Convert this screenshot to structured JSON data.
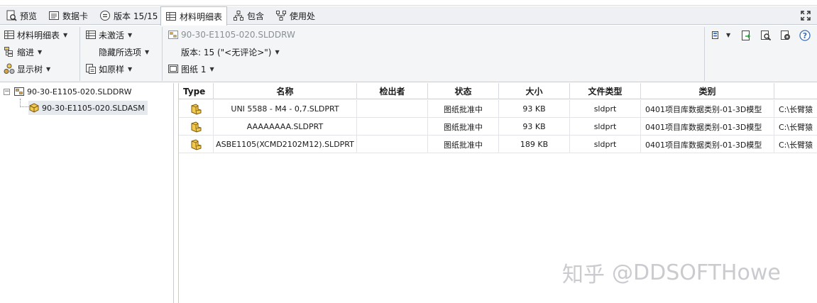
{
  "tabs": [
    {
      "label": "预览",
      "icon": "preview-icon"
    },
    {
      "label": "数据卡",
      "icon": "datacard-icon"
    },
    {
      "label": "版本 15/15",
      "icon": "version-icon"
    },
    {
      "label": "材料明细表",
      "icon": "bom-table-icon",
      "active": true
    },
    {
      "label": "包含",
      "icon": "contains-icon"
    },
    {
      "label": "使用处",
      "icon": "where-used-icon"
    }
  ],
  "toolbar": {
    "bom_label": "材料明细表",
    "indent_label": "缩进",
    "show_tree_label": "显示树",
    "not_active_label": "未激活",
    "hide_options_label": "隐藏所选项",
    "as_built_label": "如原样",
    "file_name": "90-30-E1105-020.SLDDRW",
    "version_text": "版本: 15 (\"<无评论>\")",
    "sheet_label": "图纸 1"
  },
  "tree": {
    "root": "90-30-E1105-020.SLDDRW",
    "child": "90-30-E1105-020.SLDASM"
  },
  "table": {
    "headers": [
      "Type",
      "名称",
      "检出者",
      "状态",
      "大小",
      "文件类型",
      "类别",
      ""
    ],
    "rows": [
      {
        "name": "UNI 5588 - M4 - 0,7.SLDPRT",
        "checked_out_by": "",
        "state": "图纸批准中",
        "size": "93 KB",
        "file_type": "sldprt",
        "category": "0401项目库数据类别-01-3D模型",
        "path": "C:\\长臂猿"
      },
      {
        "name": "AAAAAAAA.SLDPRT",
        "checked_out_by": "",
        "state": "图纸批准中",
        "size": "93 KB",
        "file_type": "sldprt",
        "category": "0401项目库数据类别-01-3D模型",
        "path": "C:\\长臂猿"
      },
      {
        "name": "ASBE1105(XCMD2102M12).SLDPRT",
        "checked_out_by": "",
        "state": "图纸批准中",
        "size": "189 KB",
        "file_type": "sldprt",
        "category": "0401项目库数据类别-01-3D模型",
        "path": "C:\\长臂猿"
      }
    ]
  },
  "watermark": {
    "brand": "知乎",
    "handle": "@DDSOFTHowe"
  }
}
